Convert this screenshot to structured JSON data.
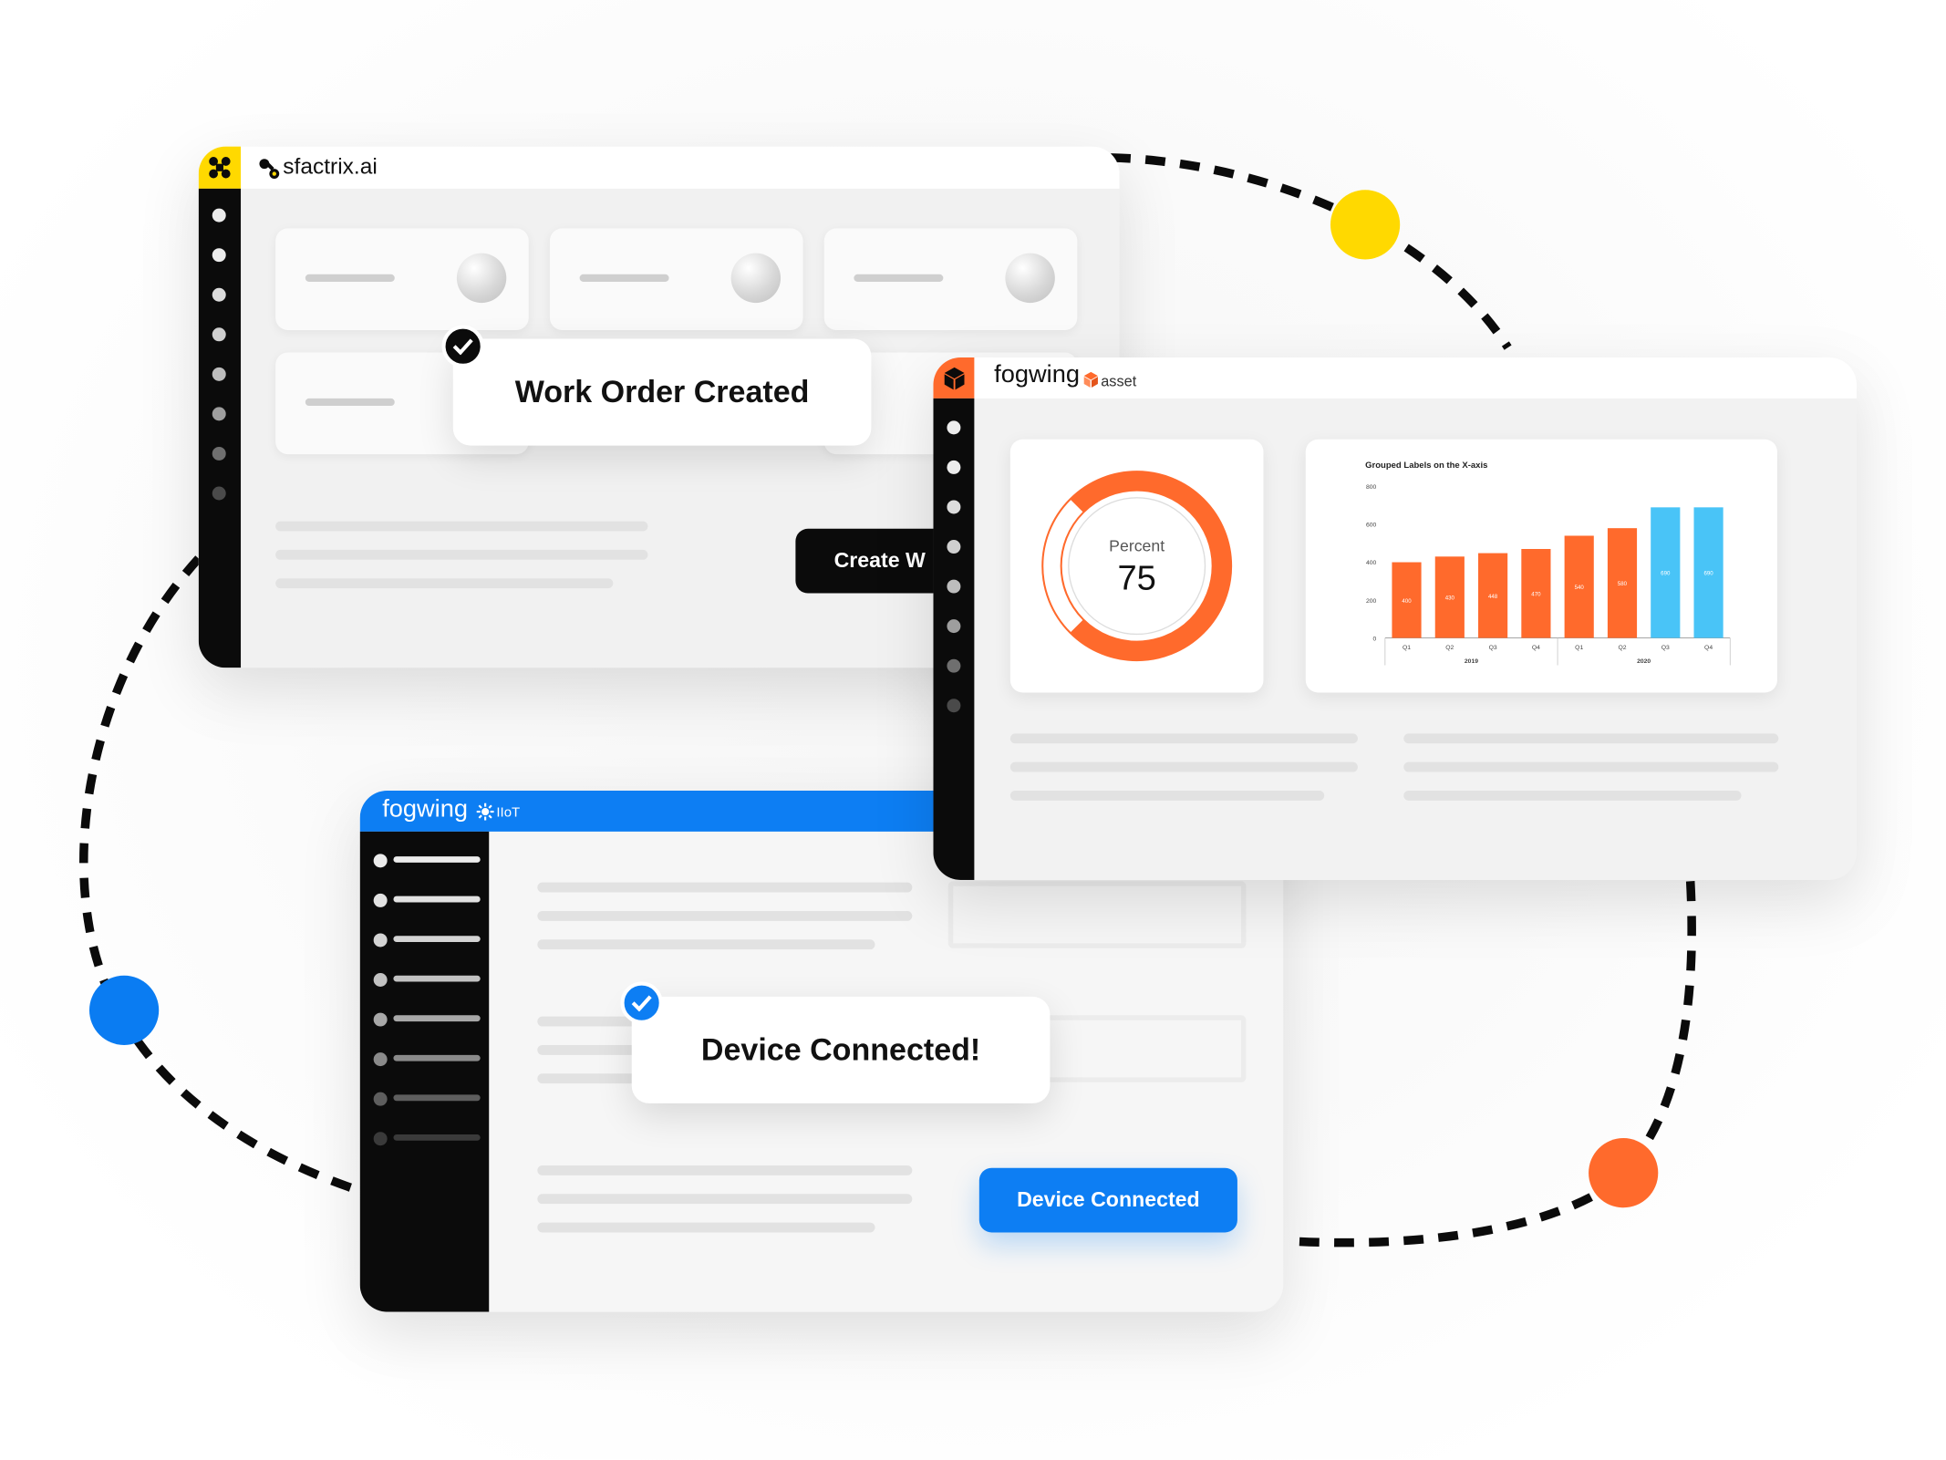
{
  "colors": {
    "yellow": "#ffd900",
    "orange": "#ff6a2c",
    "blue": "#0a7cf2",
    "iot_blue": "#0d7ef3",
    "black": "#0b0b0b",
    "cyan": "#49c4f7"
  },
  "sfactrix": {
    "brand": "sfactrix.ai",
    "icon": "sfactrix-logo-icon",
    "toast": "Work Order Created",
    "button": "Create W"
  },
  "asset": {
    "brand": "fogwing",
    "suffix": "asset",
    "icon": "cube-icon",
    "gauge": {
      "label": "Percent",
      "value": "75",
      "percent": 75
    }
  },
  "iot": {
    "brand": "fogwing",
    "suffix": "IIoT",
    "toast": "Device Connected!",
    "button": "Device Connected"
  },
  "chart_data": {
    "type": "bar",
    "title": "Grouped Labels on the X-axis",
    "categories": [
      "Q1",
      "Q2",
      "Q3",
      "Q4",
      "Q1",
      "Q2",
      "Q3",
      "Q4"
    ],
    "groups": [
      {
        "label": "2019",
        "categories": [
          "Q1",
          "Q2",
          "Q3",
          "Q4"
        ]
      },
      {
        "label": "2020",
        "categories": [
          "Q1",
          "Q2",
          "Q3",
          "Q4"
        ]
      }
    ],
    "values": [
      400,
      430,
      448,
      470,
      540,
      580,
      690,
      690
    ],
    "bar_colors": [
      "#ff6a2c",
      "#ff6a2c",
      "#ff6a2c",
      "#ff6a2c",
      "#ff6a2c",
      "#ff6a2c",
      "#49c4f7",
      "#49c4f7"
    ],
    "yticks": [
      0,
      200,
      400,
      600,
      800
    ],
    "ylim": [
      0,
      800
    ],
    "grid": false
  }
}
